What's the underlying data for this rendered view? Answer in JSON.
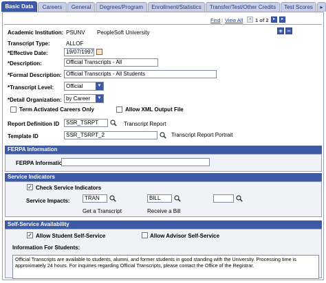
{
  "tabs": [
    {
      "label": "Basic Data",
      "active": true
    },
    {
      "label": "Careers",
      "active": false
    },
    {
      "label": "General",
      "active": false
    },
    {
      "label": "Degrees/Program",
      "active": false
    },
    {
      "label": "Enrollment/Statistics",
      "active": false
    },
    {
      "label": "Transfer/Test/Other Credits",
      "active": false
    },
    {
      "label": "Test Scores",
      "active": false
    }
  ],
  "nav": {
    "find": "Find",
    "view_all": "View All",
    "pager": "1 of 2"
  },
  "fields": {
    "institution_label": "Academic Institution:",
    "institution_code": "PSUNV",
    "institution_name": "PeopleSoft University",
    "transcript_type_label": "Transcript Type:",
    "transcript_type_value": "ALLOF",
    "effective_date_label": "*Effective Date:",
    "effective_date_value": "19/07/1997",
    "description_label": "*Description:",
    "description_value": "Official Transcripts - All",
    "formal_description_label": "*Formal Description:",
    "formal_description_value": "Official Transcripts - All Students",
    "transcript_level_label": "*Transcript Level:",
    "transcript_level_value": "Official",
    "detail_org_label": "*Detail Organization:",
    "detail_org_value": "by Career",
    "term_activated_label": "Term Activated Careers Only",
    "allow_xml_label": "Allow XML Output File",
    "report_def_label": "Report Definition ID",
    "report_def_value": "SSR_TSRPT",
    "report_def_desc": "Transcript Report",
    "template_label": "Template ID",
    "template_value": "SSR_TSRPT_2",
    "template_desc": "Transcript Report Portrait"
  },
  "ferpa": {
    "header": "FERPA Information",
    "label": "FERPA Information",
    "value": ""
  },
  "service": {
    "header": "Service Indicators",
    "check_label": "Check Service Indicators",
    "impacts_label": "Service Impacts:",
    "impact1_value": "TRAN",
    "impact1_desc": "Get a Transcript",
    "impact2_value": "BILL",
    "impact2_desc": "Receive a Bill",
    "impact3_value": ""
  },
  "self_service": {
    "header": "Self-Service Availability",
    "allow_student_label": "Allow Student Self-Service",
    "allow_advisor_label": "Allow Advisor Self-Service",
    "info_label": "Information For Students:",
    "info_text": "Official Transcripts are available to students, alumni, and former students in good standing with the University. Processing time is approximately 24 hours. For inquiries regarding Official Transcripts, please contact the Office of the Registrar."
  }
}
